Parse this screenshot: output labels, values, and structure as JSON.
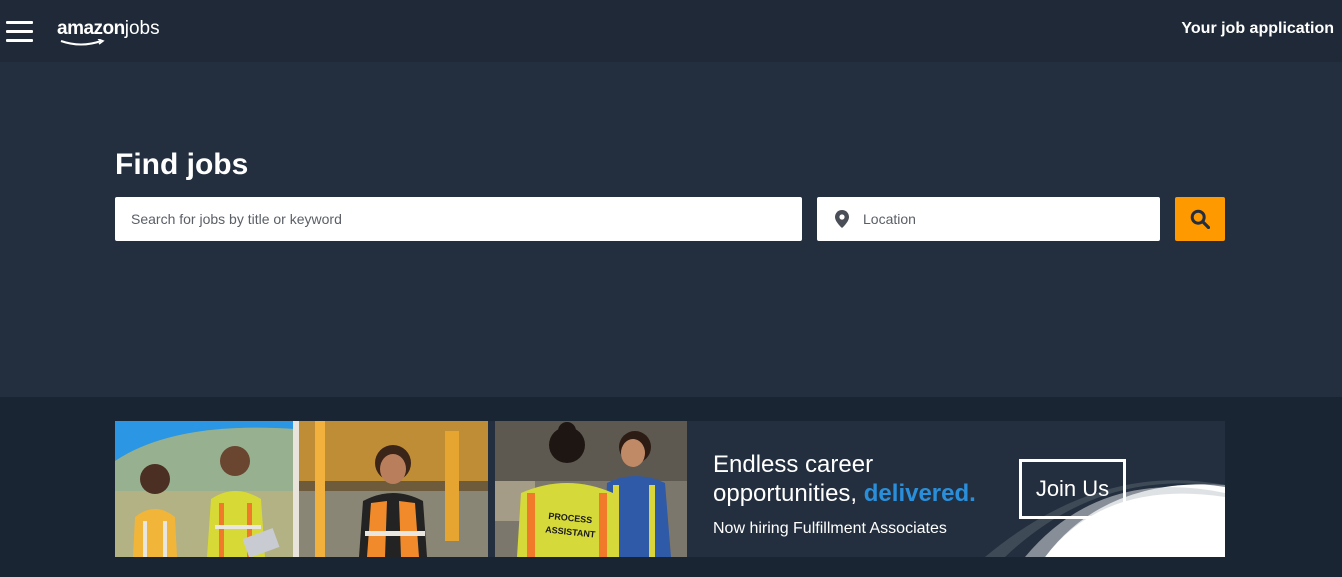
{
  "nav": {
    "logo_amazon": "amazon",
    "logo_jobs": "jobs",
    "right_link": "Your job application"
  },
  "hero": {
    "title": "Find jobs",
    "search_placeholder": "Search for jobs by title or keyword",
    "location_placeholder": "Location"
  },
  "banner": {
    "headline_line1": "Endless career",
    "headline_line2": "opportunities, ",
    "headline_accent": "delivered.",
    "subtext": "Now hiring Fulfillment Associates",
    "cta": "Join Us",
    "vest_text": "PROCESS ASSISTANT"
  },
  "colors": {
    "accent_orange": "#ff9900",
    "accent_blue": "#2a8fdb",
    "nav_bg": "#1f2937",
    "hero_bg": "#232f3e"
  }
}
